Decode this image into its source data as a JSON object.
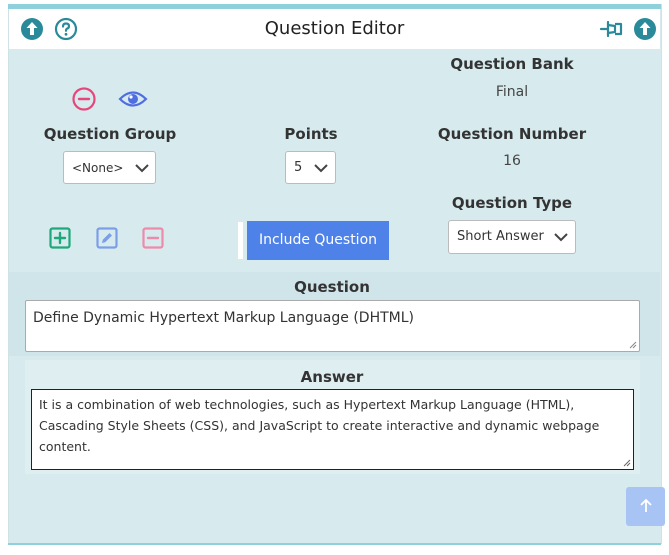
{
  "window": {
    "title": "Question Editor"
  },
  "header": {
    "left_icons": [
      "arrow-up-circle-icon",
      "help-circle-icon"
    ],
    "right_icons": [
      "pin-icon",
      "arrow-up-circle-icon"
    ]
  },
  "question_bank": {
    "label": "Question Bank",
    "value": "Final"
  },
  "question_group": {
    "label": "Question Group",
    "selected": "<None>"
  },
  "points": {
    "label": "Points",
    "selected": "5"
  },
  "question_number": {
    "label": "Question Number",
    "value": "16"
  },
  "question_type": {
    "label": "Question Type",
    "selected": "Short Answer"
  },
  "actions": {
    "include_label": "Include Question"
  },
  "question": {
    "label": "Question",
    "text": "Define Dynamic Hypertext Markup Language (DHTML)"
  },
  "answer": {
    "label": "Answer",
    "text": "It is a combination of web technologies, such as Hypertext Markup Language (HTML), Cascading Style Sheets (CSS), and JavaScript to create interactive and dynamic webpage content."
  },
  "colors": {
    "accent": "#4f82e8",
    "teal": "#2a8a9a",
    "remove": "#e8467a",
    "add": "#1fa87a",
    "frame": "#d7ebef"
  }
}
